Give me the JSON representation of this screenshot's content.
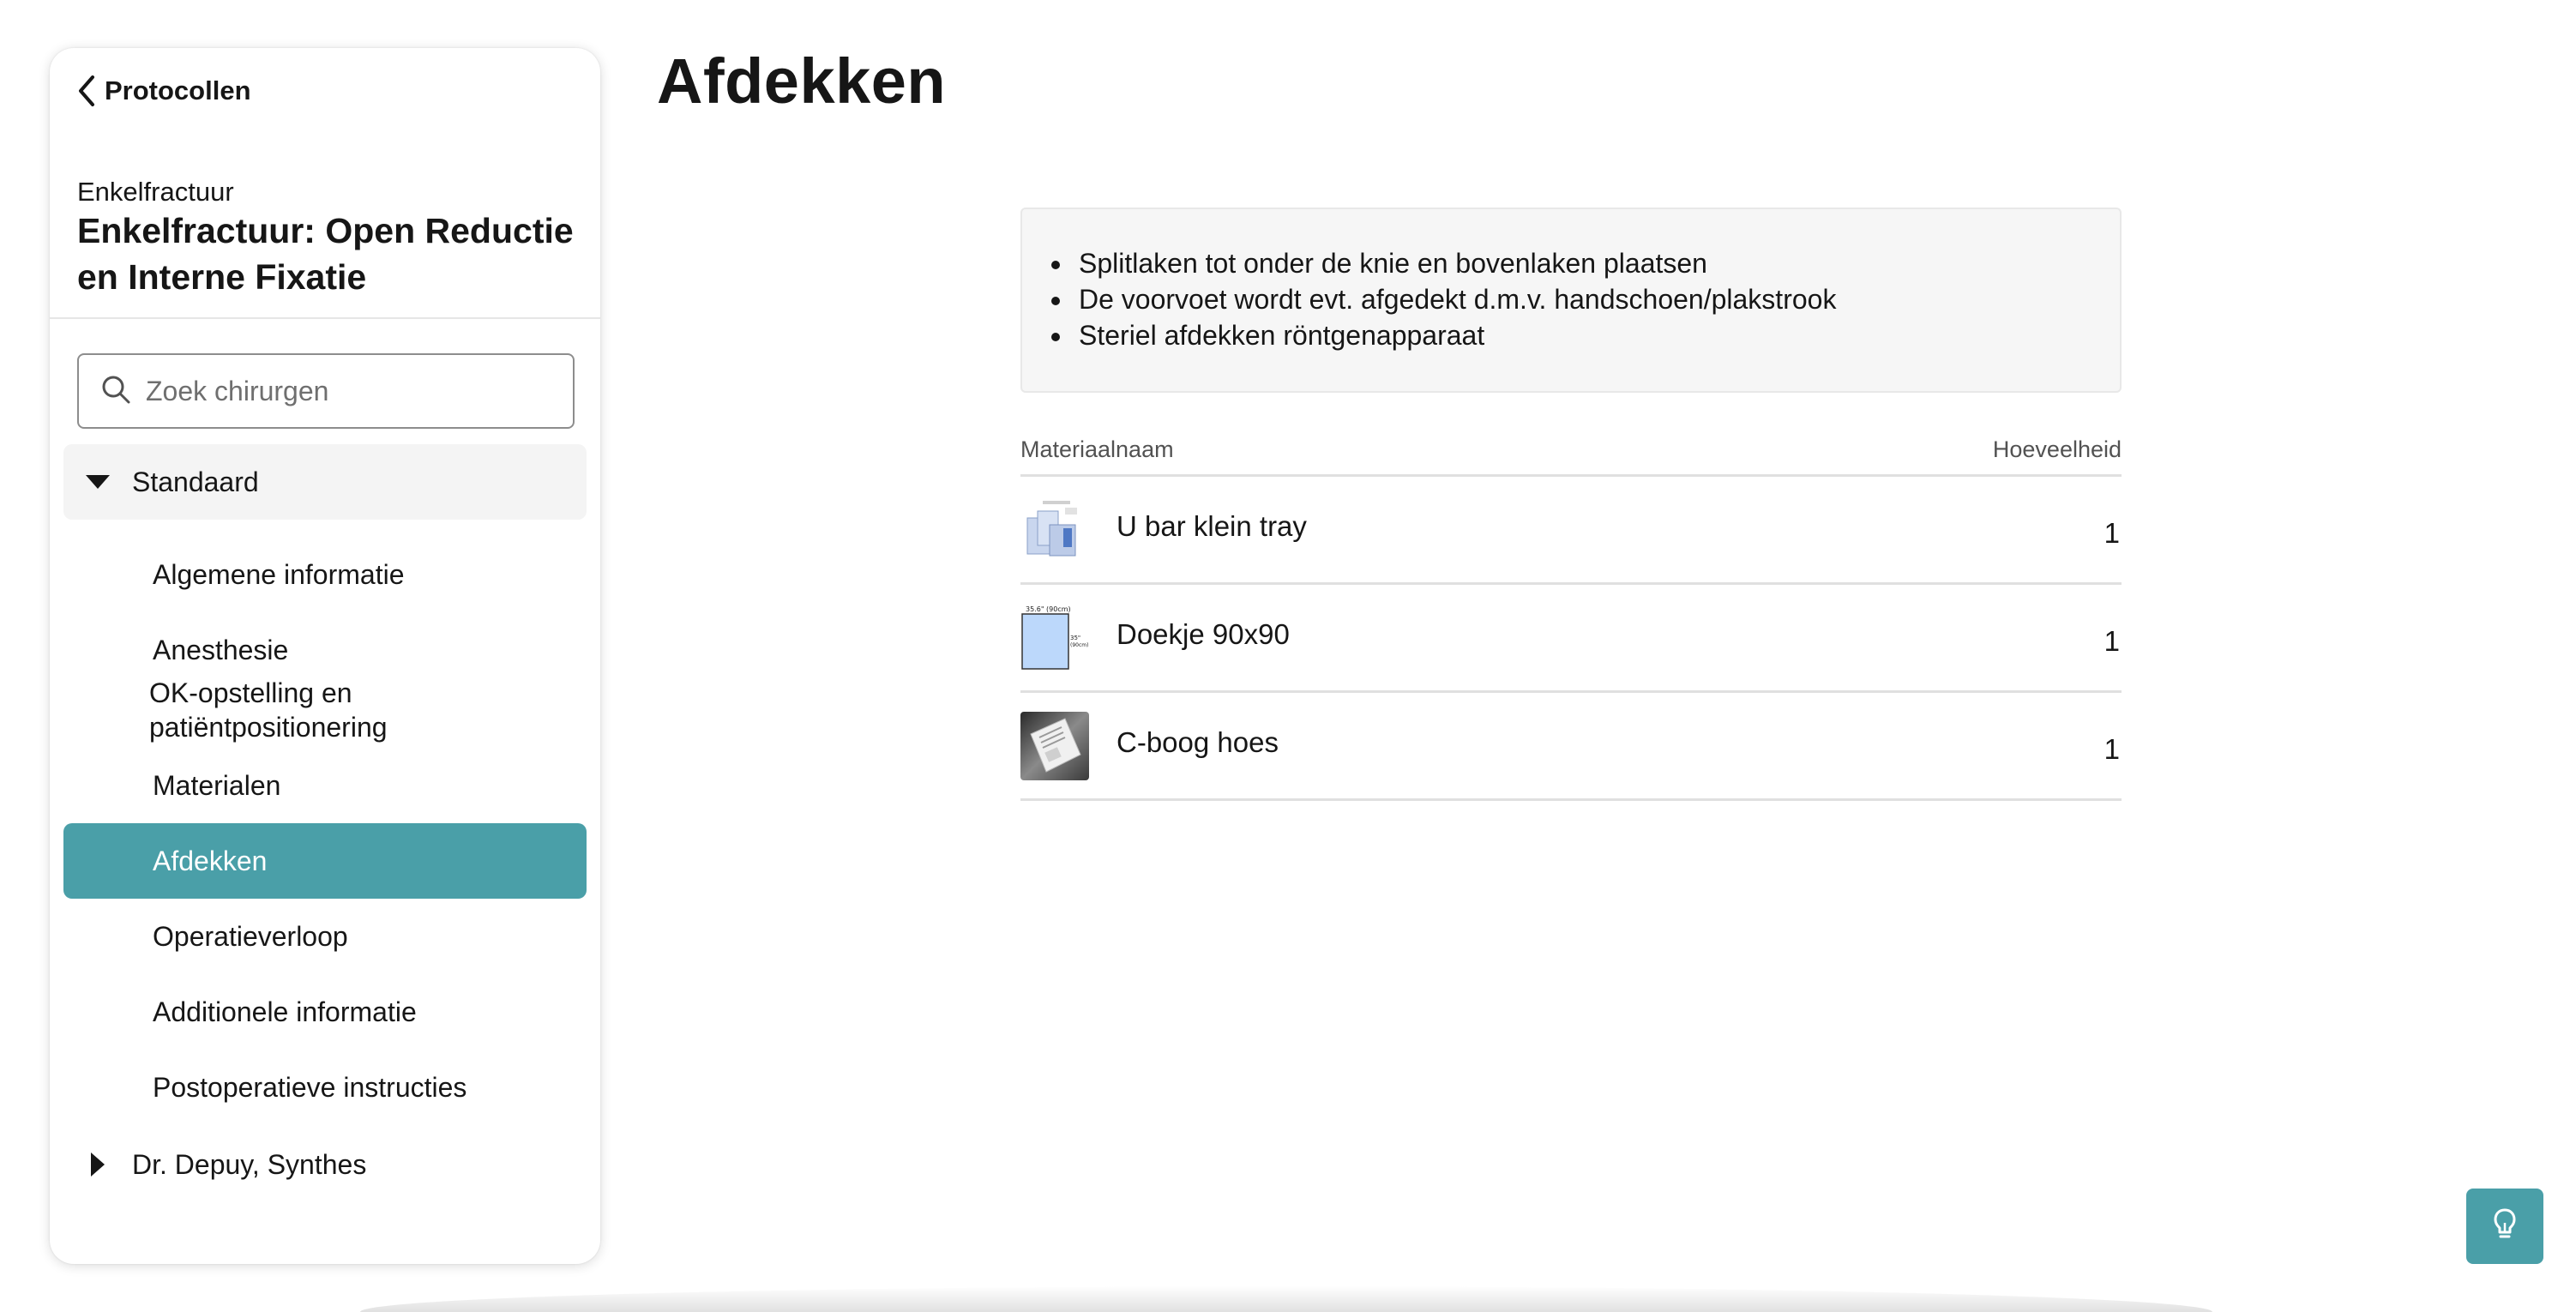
{
  "sidebar": {
    "back_label": "Protocollen",
    "subtitle": "Enkelfractuur",
    "title": "Enkelfractuur: Open Reductie en Interne Fixatie",
    "search_placeholder": "Zoek chirurgen",
    "group_expanded": {
      "label": "Standaard",
      "items": [
        {
          "label": "Algemene informatie"
        },
        {
          "label": "Anesthesie"
        },
        {
          "label": "OK-opstelling en patiëntpositionering"
        },
        {
          "label": "Materialen"
        },
        {
          "label": "Afdekken",
          "active": true
        },
        {
          "label": "Operatieverloop"
        },
        {
          "label": "Additionele informatie"
        },
        {
          "label": "Postoperatieve instructies"
        }
      ]
    },
    "group_collapsed": {
      "label": "Dr. Depuy, Synthes"
    }
  },
  "main": {
    "title": "Afdekken",
    "notes": [
      "Splitlaken tot onder de knie en bovenlaken plaatsen",
      "De voorvoet wordt evt. afgedekt d.m.v. handschoen/plakstrook",
      "Steriel afdekken röntgenapparaat"
    ],
    "materials": {
      "headers": {
        "name": "Materiaalnaam",
        "quantity": "Hoeveelheid"
      },
      "rows": [
        {
          "name": "U bar klein tray",
          "quantity": "1",
          "thumb": "drape-tray-thumbnail"
        },
        {
          "name": "Doekje 90x90",
          "quantity": "1",
          "thumb": "drape-cloth-thumbnail",
          "thumb_text": [
            "35.6\" (90cm)",
            "35\"",
            "(90cm)"
          ]
        },
        {
          "name": "C-boog hoes",
          "quantity": "1",
          "thumb": "c-arm-cover-thumbnail"
        }
      ]
    }
  },
  "colors": {
    "accent": "#4a9fa8",
    "text": "#161616",
    "muted": "#525252",
    "notes_bg": "#f6f6f6",
    "group_bg": "#f4f4f4"
  },
  "icons": {
    "back": "chevron-left-icon",
    "search": "search-icon",
    "expanded": "caret-down-icon",
    "collapsed": "caret-right-icon",
    "tip": "lightbulb-icon"
  }
}
